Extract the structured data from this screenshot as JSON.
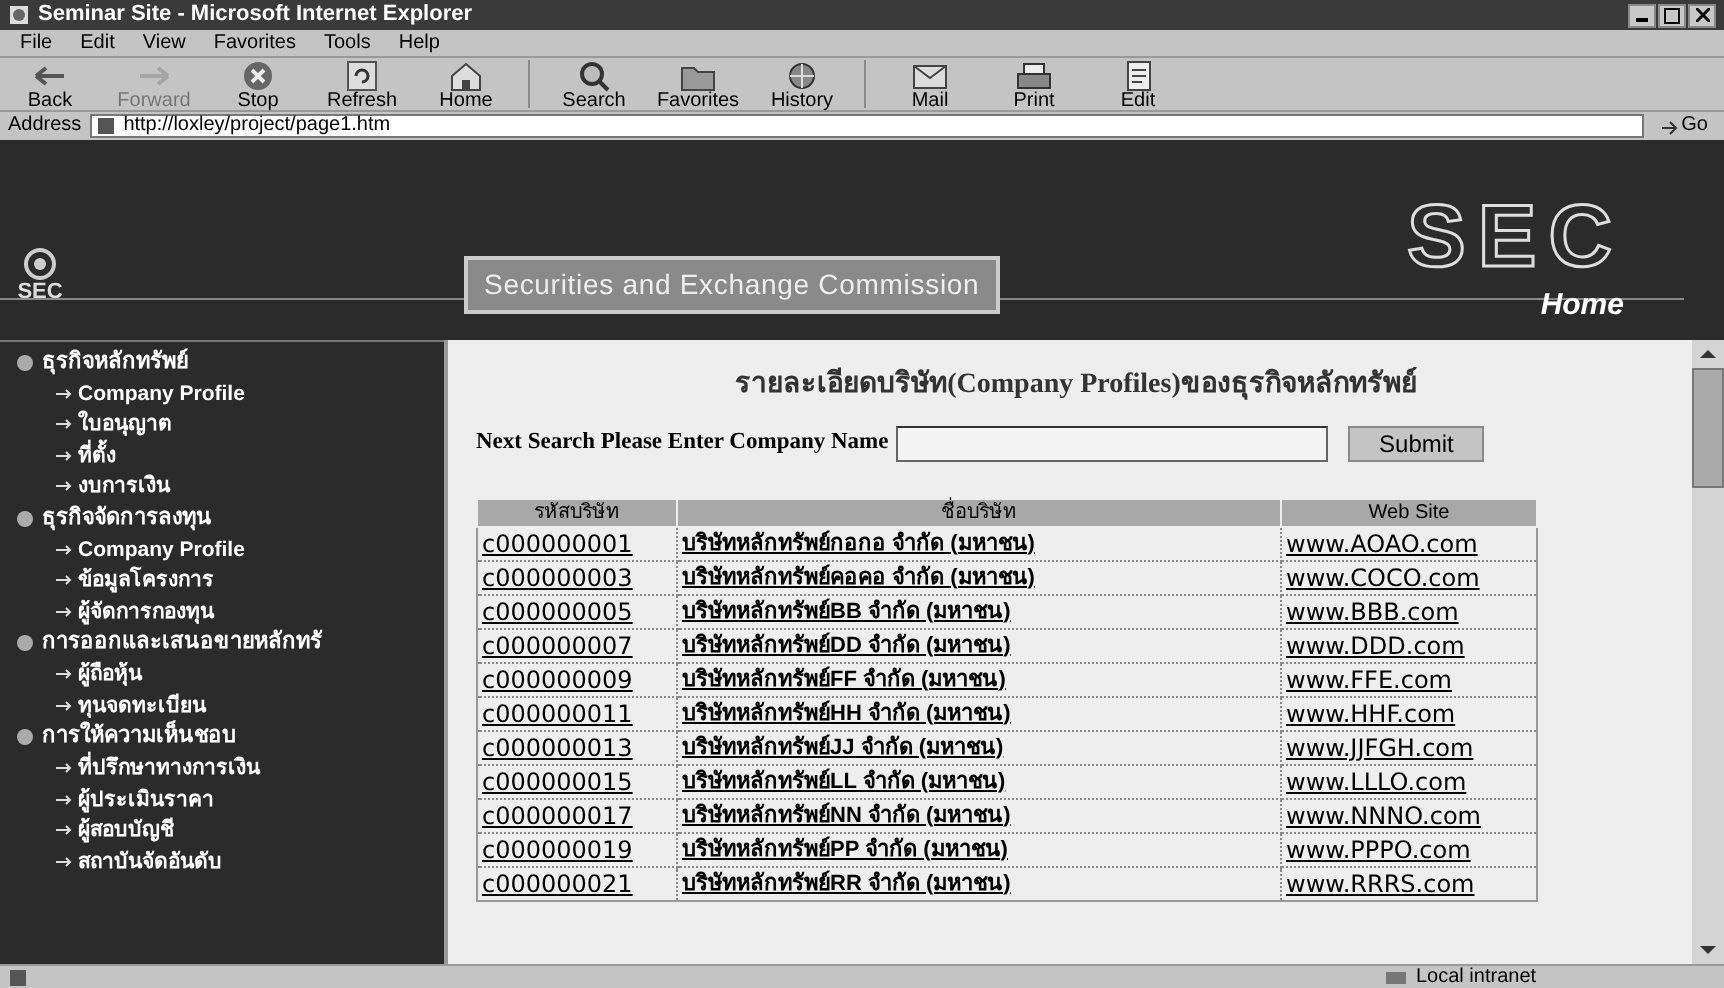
{
  "window": {
    "title": "Seminar Site - Microsoft Internet Explorer"
  },
  "menu": [
    "File",
    "Edit",
    "View",
    "Favorites",
    "Tools",
    "Help"
  ],
  "toolbar": [
    {
      "kind": "back",
      "label": "Back",
      "disabled": false
    },
    {
      "kind": "forward",
      "label": "Forward",
      "disabled": true
    },
    {
      "kind": "stop",
      "label": "Stop",
      "disabled": false
    },
    {
      "kind": "refresh",
      "label": "Refresh",
      "disabled": false
    },
    {
      "kind": "home",
      "label": "Home",
      "disabled": false
    },
    {
      "kind": "search",
      "label": "Search",
      "disabled": false
    },
    {
      "kind": "favorites",
      "label": "Favorites",
      "disabled": false
    },
    {
      "kind": "history",
      "label": "History",
      "disabled": false
    },
    {
      "kind": "mail",
      "label": "Mail",
      "disabled": false
    },
    {
      "kind": "print",
      "label": "Print",
      "disabled": false
    },
    {
      "kind": "edit",
      "label": "Edit",
      "disabled": false
    }
  ],
  "address": {
    "label": "Address",
    "value": "http://loxley/project/page1.htm",
    "go": "Go"
  },
  "banner": {
    "tagline": "Securities and Exchange Commission",
    "logo_small": "SEC",
    "logo_big": "SEC",
    "home": "Home"
  },
  "sidebar": [
    {
      "label": "ธุรกิจหลักทรัพย์",
      "children": [
        {
          "label": "Company Profile"
        },
        {
          "label": "ใบอนุญาต"
        },
        {
          "label": "ที่ตั้ง"
        },
        {
          "label": "งบการเงิน"
        }
      ]
    },
    {
      "label": "ธุรกิจจัดการลงทุน",
      "children": [
        {
          "label": "Company Profile"
        },
        {
          "label": "ข้อมูลโครงการ"
        },
        {
          "label": "ผู้จัดการกองทุน"
        }
      ]
    },
    {
      "label": "การออกและเสนอขายหลักทรั",
      "children": [
        {
          "label": "ผู้ถือหุ้น"
        },
        {
          "label": "ทุนจดทะเบียน"
        }
      ]
    },
    {
      "label": "การให้ความเห็นชอบ",
      "children": [
        {
          "label": "ที่ปรึกษาทางการเงิน"
        },
        {
          "label": "ผู้ประเมินราคา"
        },
        {
          "label": "ผู้สอบบัญชี"
        },
        {
          "label": "สถาบันจัดอันดับ"
        }
      ]
    }
  ],
  "content": {
    "heading": "รายละเอียดบริษัท(Company Profiles)ของธุรกิจหลักทรัพย์",
    "search_label": "Next Search Please Enter Company Name",
    "submit": "Submit"
  },
  "table": {
    "columns": [
      "รหัสบริษัท",
      "ชื่อบริษัท",
      "Web Site"
    ],
    "rows": [
      [
        "c000000001",
        "บริษัทหลักทรัพย์กอกอ จำกัด (มหาชน)",
        "www.AOAO.com"
      ],
      [
        "c000000003",
        "บริษัทหลักทรัพย์คอคอ จำกัด (มหาชน)",
        "www.COCO.com"
      ],
      [
        "c000000005",
        "บริษัทหลักทรัพย์BB จำกัด (มหาชน)",
        "www.BBB.com"
      ],
      [
        "c000000007",
        "บริษัทหลักทรัพย์DD จำกัด (มหาชน)",
        "www.DDD.com"
      ],
      [
        "c000000009",
        "บริษัทหลักทรัพย์FF จำกัด (มหาชน)",
        "www.FFE.com"
      ],
      [
        "c000000011",
        "บริษัทหลักทรัพย์HH จำกัด (มหาชน)",
        "www.HHF.com"
      ],
      [
        "c000000013",
        "บริษัทหลักทรัพย์JJ จำกัด (มหาชน)",
        "www.JJFGH.com"
      ],
      [
        "c000000015",
        "บริษัทหลักทรัพย์LL จำกัด (มหาชน)",
        "www.LLLO.com"
      ],
      [
        "c000000017",
        "บริษัทหลักทรัพย์NN จำกัด (มหาชน)",
        "www.NNNO.com"
      ],
      [
        "c000000019",
        "บริษัทหลักทรัพย์PP จำกัด (มหาชน)",
        "www.PPPO.com"
      ],
      [
        "c000000021",
        "บริษัทหลักทรัพย์RR จำกัด (มหาชน)",
        "www.RRRS.com"
      ]
    ]
  },
  "status_bar": {
    "zone": "Local intranet"
  }
}
